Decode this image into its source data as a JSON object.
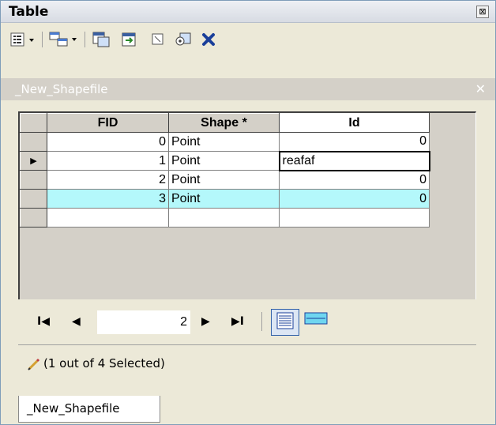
{
  "window": {
    "title": "Table",
    "close_glyph": "⊠"
  },
  "toolbar": {
    "buttons": [
      {
        "name": "table-options-icon"
      },
      {
        "name": "related-tables-icon"
      },
      {
        "name": "select-by-attributes-icon"
      },
      {
        "name": "switch-selection-icon"
      },
      {
        "name": "clear-selection-icon"
      },
      {
        "name": "zoom-to-selected-icon"
      },
      {
        "name": "delete-selected-icon"
      }
    ]
  },
  "pane": {
    "title": "_New_Shapefile",
    "close": "✕"
  },
  "grid": {
    "columns": [
      "FID",
      "Shape *",
      "Id"
    ],
    "rows": [
      {
        "fid": "0",
        "shape": "Point",
        "id": "0"
      },
      {
        "fid": "1",
        "shape": "Point",
        "id": "reafaf"
      },
      {
        "fid": "2",
        "shape": "Point",
        "id": "0"
      },
      {
        "fid": "3",
        "shape": "Point",
        "id": "0"
      }
    ],
    "current_row_marker": "▶"
  },
  "nav": {
    "first": "I◀",
    "prev": "◀",
    "page": "2",
    "next": "▶",
    "last": "▶I"
  },
  "status": {
    "text": "(1 out of 4 Selected)"
  },
  "tabs": {
    "active": "_New_Shapefile"
  },
  "colors": {
    "selected_row": "#b4f8fb",
    "accent": "#3060a8"
  }
}
